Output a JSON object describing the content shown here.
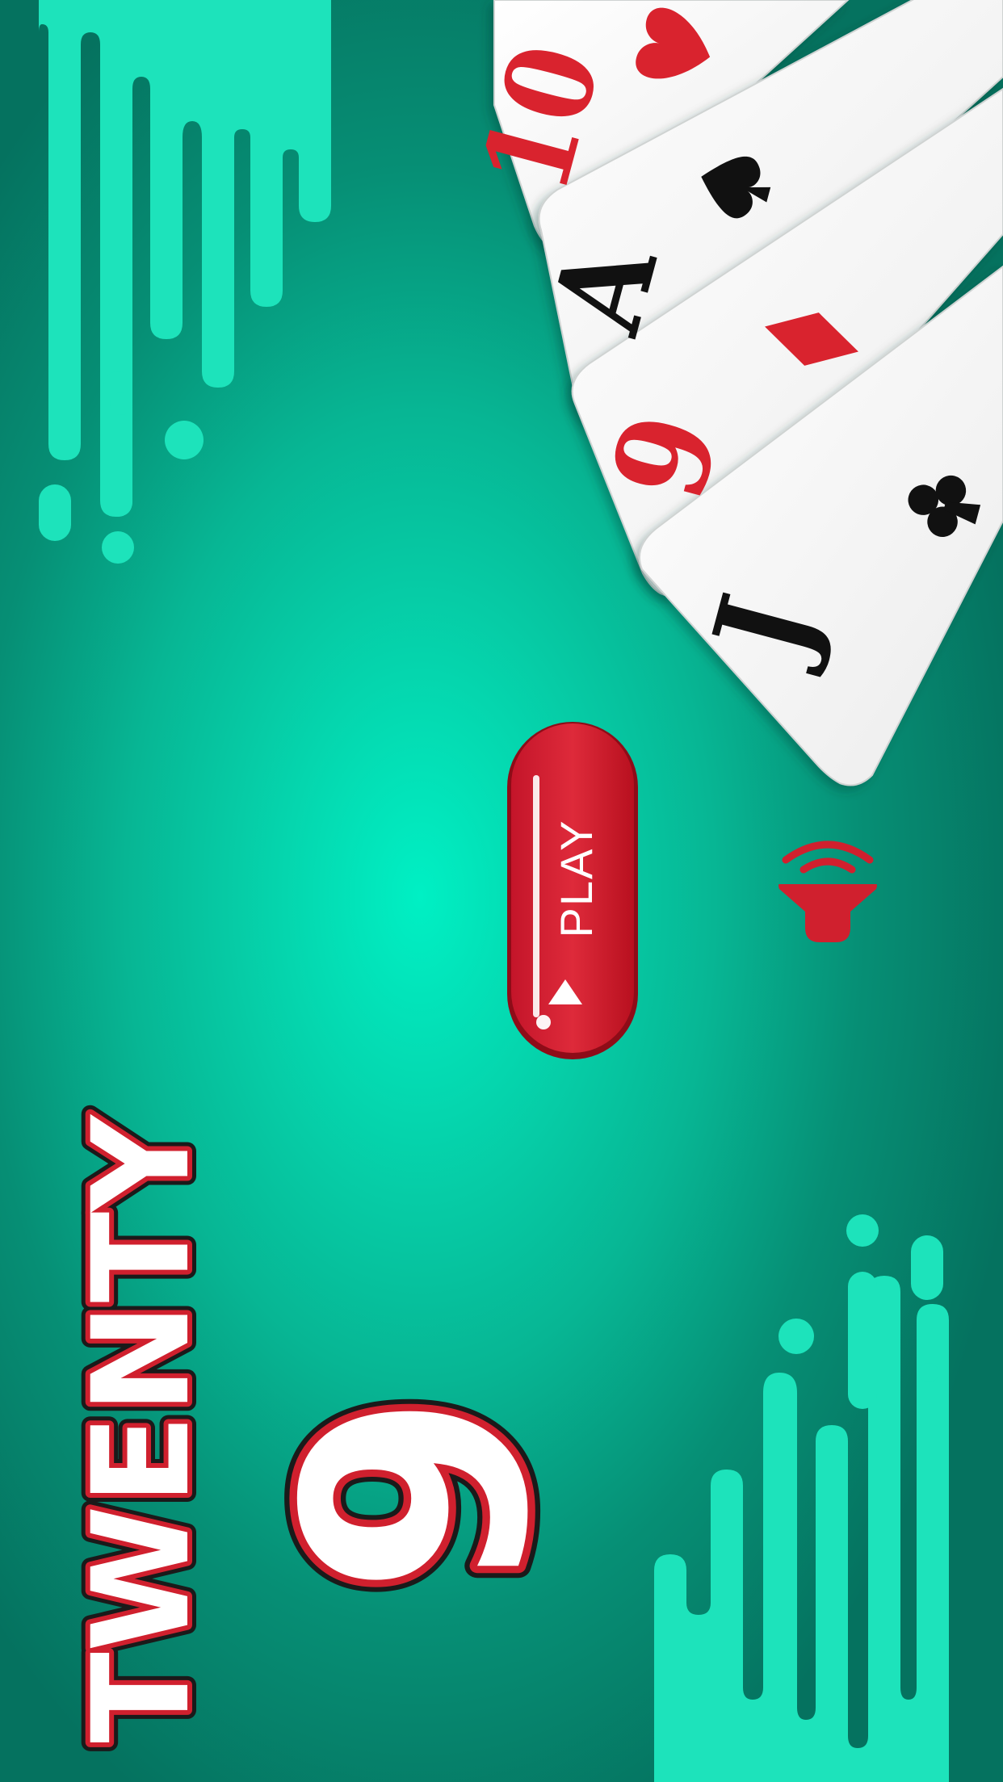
{
  "game": {
    "title_word": "TWENTY",
    "title_number": "9"
  },
  "play_button": {
    "label": "PLAY"
  },
  "cards": [
    {
      "rank": "10",
      "suit": "hearts",
      "color": "#d9232e"
    },
    {
      "rank": "A",
      "suit": "spades",
      "color": "#111111"
    },
    {
      "rank": "9",
      "suit": "diamonds",
      "color": "#d9232e"
    },
    {
      "rank": "J",
      "suit": "clubs",
      "color": "#111111"
    }
  ],
  "sound_icon": "speaker-waves-icon",
  "colors": {
    "accent_red": "#d0202e",
    "teal_light": "#1de3bb",
    "teal_glow": "#00f0c4",
    "teal_dark": "#05725f"
  }
}
